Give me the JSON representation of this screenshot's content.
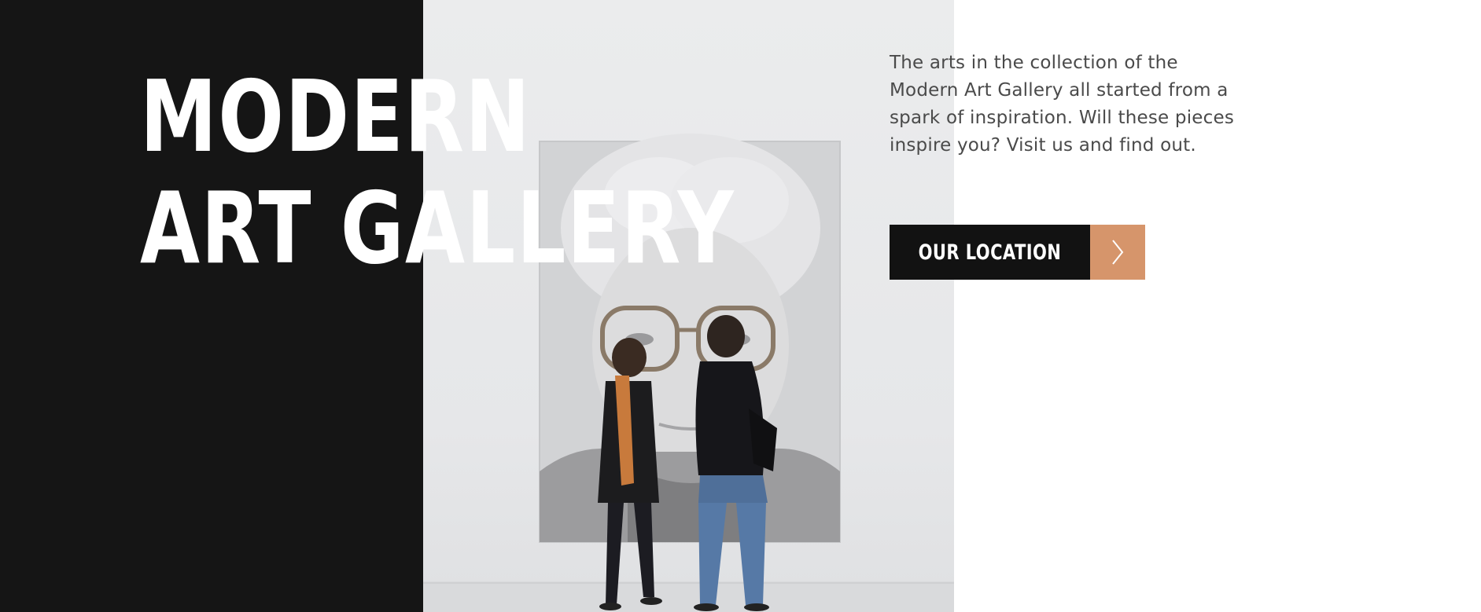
{
  "hero": {
    "title_line1": "MODERN",
    "title_line2": "ART GALLERY",
    "description": "The arts in the collection of the Modern Art Gallery all started from a spark of inspiration. Will these pieces inspire you? Visit us and find out.",
    "cta_label": "OUR LOCATION",
    "cta_icon": "chevron-right-icon"
  },
  "image": {
    "subject": "gallery-visitors-photo"
  },
  "colors": {
    "dark_panel": "#151515",
    "accent": "#d6956b",
    "button_bg": "#121212",
    "text_body": "#4a4a4a",
    "heading": "#ffffff"
  }
}
